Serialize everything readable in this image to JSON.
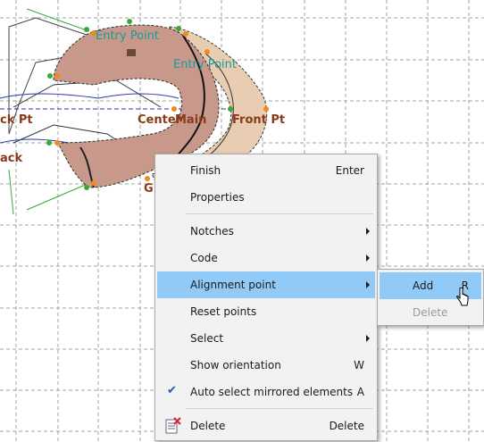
{
  "canvas_labels": {
    "entry_point_1": "Entry Point",
    "entry_point_2": "Entry Point",
    "back_pt": "ck Pt",
    "center": "Center",
    "main": "Main",
    "front_pt": "Front Pt",
    "back": "ack",
    "g_label": "G"
  },
  "context_menu": {
    "items": [
      {
        "label": "Finish",
        "shortcut": "Enter"
      },
      {
        "label": "Properties",
        "shortcut": ""
      },
      {
        "label": "Notches",
        "shortcut": ""
      },
      {
        "label": "Code",
        "shortcut": ""
      },
      {
        "label": "Alignment point",
        "shortcut": ""
      },
      {
        "label": "Reset points",
        "shortcut": ""
      },
      {
        "label": "Select",
        "shortcut": ""
      },
      {
        "label": "Show orientation",
        "shortcut": "W"
      },
      {
        "label": "Auto select mirrored elements",
        "shortcut": "A"
      },
      {
        "label": "Delete",
        "shortcut": "Delete"
      }
    ],
    "highlighted": "Alignment point",
    "checked": "Auto select mirrored elements"
  },
  "submenu": {
    "items": [
      {
        "label": "Add",
        "shortcut": "R"
      },
      {
        "label": "Delete",
        "shortcut": ""
      }
    ],
    "highlighted": "Add",
    "disabled": "Delete"
  },
  "colors": {
    "piece_fill": "#c8998a",
    "piece_fill_light": "#e8cdb3",
    "grid": "#a0a0a0",
    "highlight": "#91c9f7",
    "point_green": "#3aa83a",
    "point_orange": "#f08a1a"
  }
}
